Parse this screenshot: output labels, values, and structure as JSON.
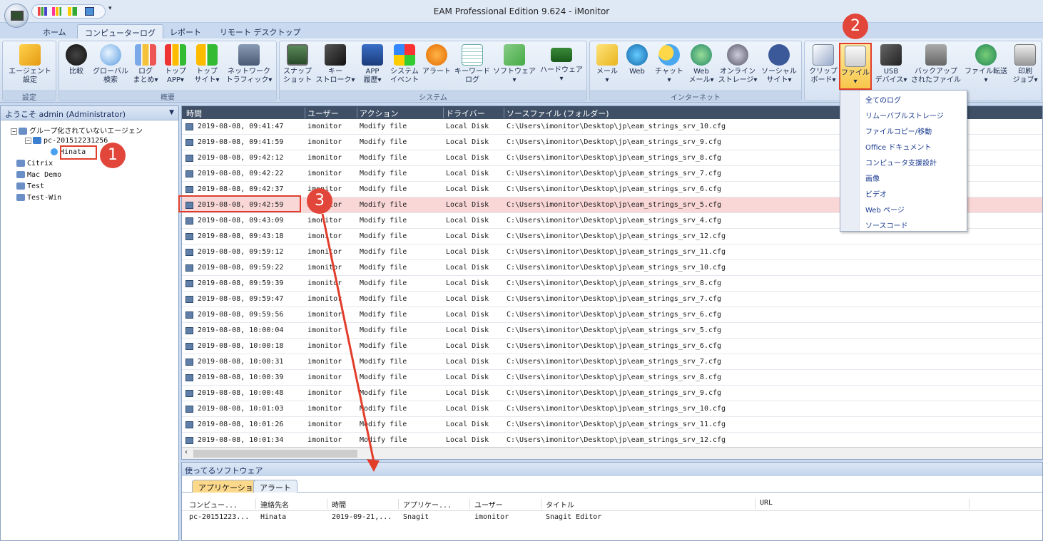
{
  "window": {
    "title": "EAM Professional Edition 9.624 - iMonitor"
  },
  "tabs": [
    "ホーム",
    "コンピューターログ",
    "レポート",
    "リモート デスクトップ"
  ],
  "ribbon": {
    "groups": [
      {
        "label": "設定",
        "buttons": [
          {
            "l1": "エージェント",
            "l2": "設定",
            "icon": "agent-settings-icon"
          }
        ]
      },
      {
        "label": "概要",
        "buttons": [
          {
            "l1": "比較",
            "l2": "",
            "icon": "compare-icon"
          },
          {
            "l1": "グローバル",
            "l2": "検索",
            "icon": "global-search-icon"
          },
          {
            "l1": "ログ",
            "l2": "まとめ▾",
            "icon": "log-summary-icon"
          },
          {
            "l1": "トップ",
            "l2": "APP▾",
            "icon": "top-app-icon"
          },
          {
            "l1": "トップ",
            "l2": "サイト▾",
            "icon": "top-site-icon"
          },
          {
            "l1": "ネットワーク",
            "l2": "トラフィック▾",
            "icon": "network-traffic-icon"
          }
        ]
      },
      {
        "label": "システム",
        "buttons": [
          {
            "l1": "スナップ",
            "l2": "ショット",
            "icon": "snapshot-icon"
          },
          {
            "l1": "キー",
            "l2": "ストローク▾",
            "icon": "keystroke-icon"
          },
          {
            "l1": "APP",
            "l2": "履歴▾",
            "icon": "app-history-icon"
          },
          {
            "l1": "システム",
            "l2": "イベント",
            "icon": "system-event-icon"
          },
          {
            "l1": "アラート",
            "l2": "",
            "icon": "alert-icon"
          },
          {
            "l1": "キーワード",
            "l2": "ログ",
            "icon": "keyword-log-icon"
          },
          {
            "l1": "ソフトウェア",
            "l2": "▾",
            "icon": "software-icon"
          },
          {
            "l1": "ハードウェア",
            "l2": "▾",
            "icon": "hardware-icon"
          }
        ]
      },
      {
        "label": "インターネット",
        "buttons": [
          {
            "l1": "メール",
            "l2": "▾",
            "icon": "mail-icon"
          },
          {
            "l1": "Web",
            "l2": "",
            "icon": "web-icon"
          },
          {
            "l1": "チャット",
            "l2": "▾",
            "icon": "chat-icon"
          },
          {
            "l1": "Web",
            "l2": "メール▾",
            "icon": "webmail-icon"
          },
          {
            "l1": "オンライン",
            "l2": "ストレージ▾",
            "icon": "online-storage-icon"
          },
          {
            "l1": "ソーシャル",
            "l2": "サイト▾",
            "icon": "social-site-icon"
          }
        ]
      },
      {
        "label": "",
        "buttons": [
          {
            "l1": "クリップ",
            "l2": "ボード▾",
            "icon": "clipboard-icon"
          },
          {
            "l1": "ファイル",
            "l2": "▾",
            "icon": "file-icon"
          },
          {
            "l1": "USB",
            "l2": "デバイス▾",
            "icon": "usb-device-icon"
          },
          {
            "l1": "バックアップ",
            "l2": "されたファイル",
            "icon": "backup-file-icon"
          },
          {
            "l1": "ファイル転送",
            "l2": "▾",
            "icon": "file-transfer-icon"
          },
          {
            "l1": "印刷",
            "l2": "ジョブ▾",
            "icon": "print-job-icon"
          }
        ]
      }
    ]
  },
  "sidebar": {
    "welcome": "ようこそ admin (Administrator)",
    "tree": {
      "ungrouped": "グループ化されていないエージェン",
      "pc": "pc-201512231256",
      "user": "Hinata",
      "groups": [
        "Citrix",
        "Mac Demo",
        "Test",
        "Test-Win"
      ]
    }
  },
  "grid": {
    "columns": [
      "時間",
      "ユーザー",
      "アクション",
      "ドライバー",
      "ソースファイル (フォルダー)"
    ],
    "rows": [
      [
        "2019-08-08, 09:41:47",
        "imonitor",
        "Modify file",
        "Local Disk",
        "C:\\Users\\imonitor\\Desktop\\jp\\eam_strings_srv_10.cfg"
      ],
      [
        "2019-08-08, 09:41:59",
        "imonitor",
        "Modify file",
        "Local Disk",
        "C:\\Users\\imonitor\\Desktop\\jp\\eam_strings_srv_9.cfg"
      ],
      [
        "2019-08-08, 09:42:12",
        "imonitor",
        "Modify file",
        "Local Disk",
        "C:\\Users\\imonitor\\Desktop\\jp\\eam_strings_srv_8.cfg"
      ],
      [
        "2019-08-08, 09:42:22",
        "imonitor",
        "Modify file",
        "Local Disk",
        "C:\\Users\\imonitor\\Desktop\\jp\\eam_strings_srv_7.cfg"
      ],
      [
        "2019-08-08, 09:42:37",
        "imonitor",
        "Modify file",
        "Local Disk",
        "C:\\Users\\imonitor\\Desktop\\jp\\eam_strings_srv_6.cfg"
      ],
      [
        "2019-08-08, 09:42:59",
        "imonitor",
        "Modify file",
        "Local Disk",
        "C:\\Users\\imonitor\\Desktop\\jp\\eam_strings_srv_5.cfg"
      ],
      [
        "2019-08-08, 09:43:09",
        "imonitor",
        "Modify file",
        "Local Disk",
        "C:\\Users\\imonitor\\Desktop\\jp\\eam_strings_srv_4.cfg"
      ],
      [
        "2019-08-08, 09:43:18",
        "imonitor",
        "Modify file",
        "Local Disk",
        "C:\\Users\\imonitor\\Desktop\\jp\\eam_strings_srv_12.cfg"
      ],
      [
        "2019-08-08, 09:59:12",
        "imonitor",
        "Modify file",
        "Local Disk",
        "C:\\Users\\imonitor\\Desktop\\jp\\eam_strings_srv_11.cfg"
      ],
      [
        "2019-08-08, 09:59:22",
        "imonitor",
        "Modify file",
        "Local Disk",
        "C:\\Users\\imonitor\\Desktop\\jp\\eam_strings_srv_10.cfg"
      ],
      [
        "2019-08-08, 09:59:39",
        "imonitor",
        "Modify file",
        "Local Disk",
        "C:\\Users\\imonitor\\Desktop\\jp\\eam_strings_srv_8.cfg"
      ],
      [
        "2019-08-08, 09:59:47",
        "imonitor",
        "Modify file",
        "Local Disk",
        "C:\\Users\\imonitor\\Desktop\\jp\\eam_strings_srv_7.cfg"
      ],
      [
        "2019-08-08, 09:59:56",
        "imonitor",
        "Modify file",
        "Local Disk",
        "C:\\Users\\imonitor\\Desktop\\jp\\eam_strings_srv_6.cfg"
      ],
      [
        "2019-08-08, 10:00:04",
        "imonitor",
        "Modify file",
        "Local Disk",
        "C:\\Users\\imonitor\\Desktop\\jp\\eam_strings_srv_5.cfg"
      ],
      [
        "2019-08-08, 10:00:18",
        "imonitor",
        "Modify file",
        "Local Disk",
        "C:\\Users\\imonitor\\Desktop\\jp\\eam_strings_srv_6.cfg"
      ],
      [
        "2019-08-08, 10:00:31",
        "imonitor",
        "Modify file",
        "Local Disk",
        "C:\\Users\\imonitor\\Desktop\\jp\\eam_strings_srv_7.cfg"
      ],
      [
        "2019-08-08, 10:00:39",
        "imonitor",
        "Modify file",
        "Local Disk",
        "C:\\Users\\imonitor\\Desktop\\jp\\eam_strings_srv_8.cfg"
      ],
      [
        "2019-08-08, 10:00:48",
        "imonitor",
        "Modify file",
        "Local Disk",
        "C:\\Users\\imonitor\\Desktop\\jp\\eam_strings_srv_9.cfg"
      ],
      [
        "2019-08-08, 10:01:03",
        "imonitor",
        "Modify file",
        "Local Disk",
        "C:\\Users\\imonitor\\Desktop\\jp\\eam_strings_srv_10.cfg"
      ],
      [
        "2019-08-08, 10:01:26",
        "imonitor",
        "Modify file",
        "Local Disk",
        "C:\\Users\\imonitor\\Desktop\\jp\\eam_strings_srv_11.cfg"
      ],
      [
        "2019-08-08, 10:01:34",
        "imonitor",
        "Modify file",
        "Local Disk",
        "C:\\Users\\imonitor\\Desktop\\jp\\eam_strings_srv_12.cfg"
      ]
    ],
    "highlight_index": 5
  },
  "bottom_panel": {
    "title": "使ってるソフトウェア",
    "tabs": [
      "アプリケーション",
      "アラート"
    ],
    "columns": [
      "コンピュー...",
      "連絡先名",
      "時間",
      "アプリケー...",
      "ユーザー",
      "タイトル",
      "URL"
    ],
    "row": [
      "pc-20151223...",
      "Hinata",
      "2019-09-21,...",
      "Snagit",
      "imonitor",
      "Snagit Editor",
      ""
    ]
  },
  "file_menu": {
    "items": [
      "全てのログ",
      "リムーバブルストレージ",
      "ファイルコピー/移動",
      "Office ドキュメント",
      "コンピュータ支援設計",
      "画像",
      "ビデオ",
      "Web ページ",
      "ソースコード"
    ]
  },
  "annotations": [
    "1",
    "2",
    "3"
  ],
  "colors": {
    "highlight_row": "#f9d7d7",
    "annotation_red": "#e23d2b",
    "menu_text": "#1a3b8f"
  }
}
